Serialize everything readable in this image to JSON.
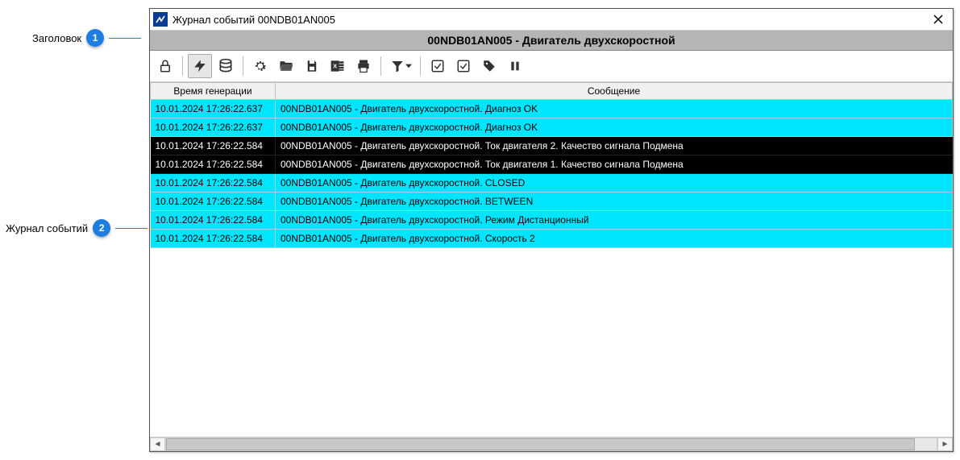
{
  "callouts": {
    "c1_label": "Заголовок",
    "c1_num": "1",
    "c2_label": "Журнал событий",
    "c2_num": "2"
  },
  "window": {
    "title": "Журнал событий 00NDB01AN005",
    "subheader": "00NDB01AN005 - Двигатель двухскоростной"
  },
  "columns": {
    "time": "Время генерации",
    "message": "Сообщение"
  },
  "rows": [
    {
      "style": "cyan",
      "time": "10.01.2024 17:26:22.637",
      "msg": "00NDB01AN005 - Двигатель двухскоростной. Диагноз OK"
    },
    {
      "style": "cyan",
      "time": "10.01.2024 17:26:22.637",
      "msg": "00NDB01AN005 - Двигатель двухскоростной. Диагноз OK"
    },
    {
      "style": "black",
      "time": "10.01.2024 17:26:22.584",
      "msg": "00NDB01AN005 - Двигатель двухскоростной. Ток двигателя 2. Качество сигнала Подмена"
    },
    {
      "style": "black",
      "time": "10.01.2024 17:26:22.584",
      "msg": "00NDB01AN005 - Двигатель двухскоростной. Ток двигателя 1. Качество сигнала Подмена"
    },
    {
      "style": "cyan",
      "time": "10.01.2024 17:26:22.584",
      "msg": "00NDB01AN005 - Двигатель двухскоростной. CLOSED"
    },
    {
      "style": "cyan",
      "time": "10.01.2024 17:26:22.584",
      "msg": "00NDB01AN005 - Двигатель двухскоростной. BETWEEN"
    },
    {
      "style": "cyan",
      "time": "10.01.2024 17:26:22.584",
      "msg": "00NDB01AN005 - Двигатель двухскоростной. Режим Дистанционный"
    },
    {
      "style": "cyan",
      "time": "10.01.2024 17:26:22.584",
      "msg": "00NDB01AN005 - Двигатель двухскоростной. Скорость 2"
    }
  ],
  "icons": {
    "lock": "lock",
    "flash": "flash",
    "database": "database",
    "gear": "gear",
    "folder": "folder",
    "save": "save",
    "excel": "excel",
    "print": "print",
    "filter": "filter",
    "check1": "check1",
    "check2": "check2",
    "tag": "tag",
    "pause": "pause"
  }
}
